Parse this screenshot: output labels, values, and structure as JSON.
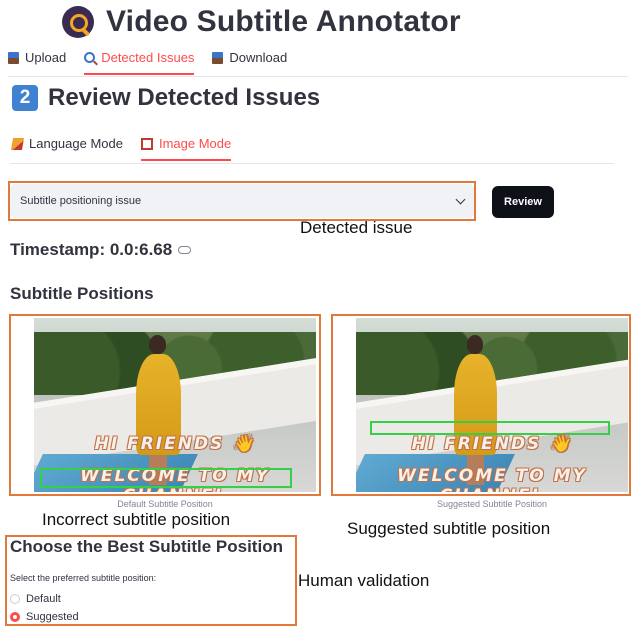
{
  "app": {
    "title": "Video Subtitle Annotator"
  },
  "main_tabs": [
    {
      "label": "Upload",
      "icon": "upload-icon"
    },
    {
      "label": "Detected Issues",
      "icon": "search-icon",
      "active": true
    },
    {
      "label": "Download",
      "icon": "download-icon"
    }
  ],
  "section": {
    "number": "2",
    "title": "Review Detected Issues"
  },
  "mode_tabs": [
    {
      "label": "Language Mode",
      "icon": "pencil-icon"
    },
    {
      "label": "Image Mode",
      "icon": "frame-icon",
      "active": true
    }
  ],
  "issue_select": {
    "value": "Subtitle positioning issue"
  },
  "review_button": {
    "label": "Review"
  },
  "annotations": {
    "detected_issue": "Detected issue",
    "incorrect_position": "Incorrect subtitle position",
    "suggested_position": "Suggested subtitle position",
    "human_validation": "Human validation"
  },
  "timestamp": {
    "label": "Timestamp: 0.0:6.68"
  },
  "subtitle_positions": {
    "heading": "Subtitle Positions",
    "default": {
      "caption": "Default Subtitle Position",
      "line1": "HI FRIENDS 👋",
      "line2": "WELCOME TO MY CHANNEL"
    },
    "suggested": {
      "caption": "Suggested Subtitle Position",
      "line1": "HI FRIENDS 👋",
      "line2": "WELCOME TO MY CHANNEL"
    }
  },
  "choose": {
    "heading": "Choose the Best Subtitle Position",
    "prompt": "Select the preferred subtitle position:",
    "options": [
      {
        "label": "Default",
        "selected": false
      },
      {
        "label": "Suggested",
        "selected": true
      }
    ]
  },
  "colors": {
    "accent": "#ff4b4b",
    "annotation_box": "#e07a3c",
    "suggested_box": "#34d146"
  }
}
